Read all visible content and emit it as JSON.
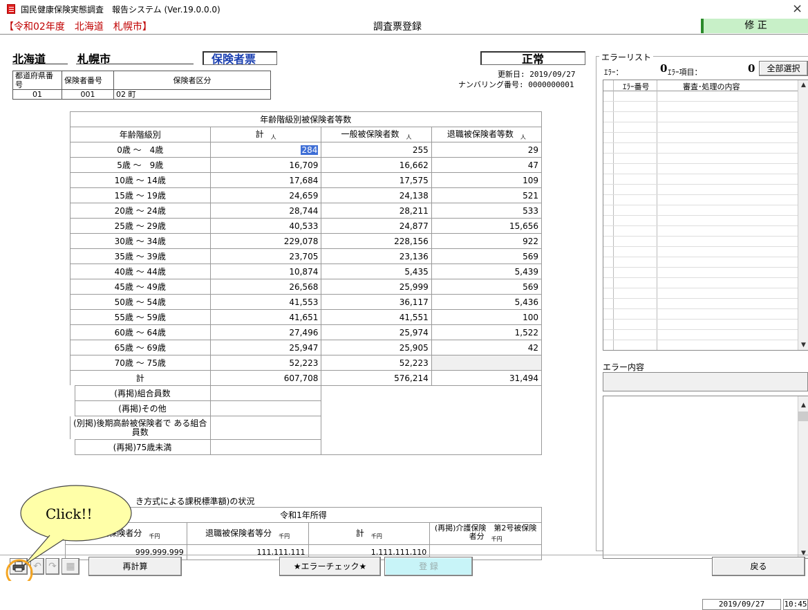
{
  "window": {
    "title": "国民健康保険実態調査　報告システム (Ver.19.0.0.0)",
    "close_glyph": "×"
  },
  "header": {
    "context": "【令和02年度　北海道　札幌市】",
    "screen_title": "調査票登録",
    "mode": "修 正"
  },
  "insurer": {
    "prefecture": "北海道",
    "city": "札幌市",
    "kind": "保険者票",
    "status": "正常",
    "updated": "更新日: 2019/09/27",
    "numbering": "ナンバリング番号: 0000000001",
    "code_headers": [
      "都道府県番号",
      "保険者番号",
      "保険者区分"
    ],
    "code_values": [
      "01",
      "001",
      "02 町"
    ]
  },
  "age_table": {
    "title": "年齢階級別被保険者等数",
    "headers": [
      "年齢階級別",
      "計",
      "一般被保険者数",
      "退職被保険者等数"
    ],
    "unit": "人",
    "rows": [
      {
        "label": "0歳 ～　4歳",
        "total": "284",
        "general": "255",
        "retired": "29"
      },
      {
        "label": "5歳 ～　9歳",
        "total": "16,709",
        "general": "16,662",
        "retired": "47"
      },
      {
        "label": "10歳 ～ 14歳",
        "total": "17,684",
        "general": "17,575",
        "retired": "109"
      },
      {
        "label": "15歳 ～ 19歳",
        "total": "24,659",
        "general": "24,138",
        "retired": "521"
      },
      {
        "label": "20歳 ～ 24歳",
        "total": "28,744",
        "general": "28,211",
        "retired": "533"
      },
      {
        "label": "25歳 ～ 29歳",
        "total": "40,533",
        "general": "24,877",
        "retired": "15,656"
      },
      {
        "label": "30歳 ～ 34歳",
        "total": "229,078",
        "general": "228,156",
        "retired": "922"
      },
      {
        "label": "35歳 ～ 39歳",
        "total": "23,705",
        "general": "23,136",
        "retired": "569"
      },
      {
        "label": "40歳 ～ 44歳",
        "total": "10,874",
        "general": "5,435",
        "retired": "5,439"
      },
      {
        "label": "45歳 ～ 49歳",
        "total": "26,568",
        "general": "25,999",
        "retired": "569"
      },
      {
        "label": "50歳 ～ 54歳",
        "total": "41,553",
        "general": "36,117",
        "retired": "5,436"
      },
      {
        "label": "55歳 ～ 59歳",
        "total": "41,651",
        "general": "41,551",
        "retired": "100"
      },
      {
        "label": "60歳 ～ 64歳",
        "total": "27,496",
        "general": "25,974",
        "retired": "1,522"
      },
      {
        "label": "65歳 ～ 69歳",
        "total": "25,947",
        "general": "25,905",
        "retired": "42"
      },
      {
        "label": "70歳 ～ 75歳",
        "total": "52,223",
        "general": "52,223",
        "retired": ""
      }
    ],
    "sum_row": {
      "label": "計",
      "total": "607,708",
      "general": "576,214",
      "retired": "31,494"
    },
    "extra_rows": [
      "(再掲)組合員数",
      "(再掲)その他",
      "(別掲)後期高齢被保険者で ある組合員数",
      "(再掲)75歳未満"
    ]
  },
  "income": {
    "section_title": "き方式による課税標準額)の状況",
    "year_header": "令和1年所得",
    "headers": [
      "般被保険者分",
      "退職被保険者等分",
      "計",
      "(再掲)介護保険　第2号被保険者分"
    ],
    "unit": "千円",
    "values": [
      "999,999,999",
      "111,111,111",
      "1,111,111,110",
      ""
    ]
  },
  "errors": {
    "panel_title": "エラーリスト",
    "error_label": "ｴﾗｰ：",
    "error_count": "0",
    "item_label": "ｴﾗｰ項目：",
    "item_count": "0",
    "select_all": "全部選択",
    "col_no": "ｴﾗｰ番号",
    "col_content": "審査･処理の内容",
    "detail_title": "エラー内容"
  },
  "callout": {
    "text": "Click!!"
  },
  "toolbar": {
    "recalc": "再計算",
    "error_check": "★エラーチェック★",
    "register": "登 録",
    "back": "戻る"
  },
  "status_bar": {
    "date": "2019/09/27",
    "time": "10:45"
  }
}
